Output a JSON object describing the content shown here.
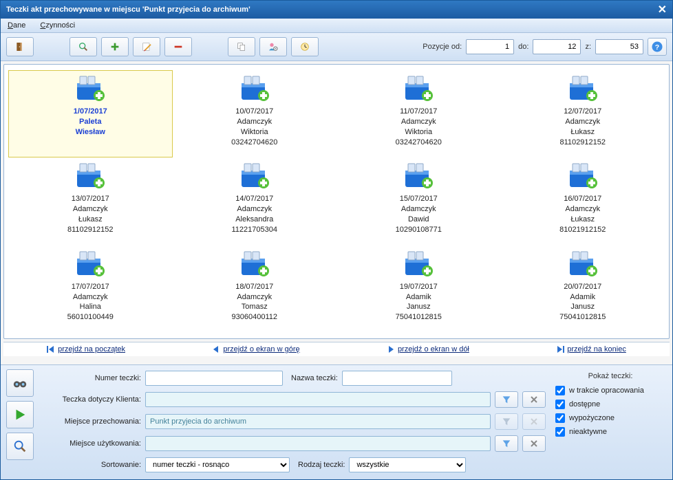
{
  "window_title": "Teczki akt przechowywane w miejscu 'Punkt przyjecia do archiwum'",
  "menu": {
    "dane": "Dane",
    "czynnosci": "Czynności"
  },
  "toolbar": {
    "pos_label_od": "Pozycje od:",
    "pos_od": "1",
    "pos_label_do": "do:",
    "pos_do": "12",
    "pos_label_z": "z:",
    "pos_z": "53"
  },
  "folders": [
    {
      "date": "1/07/2017",
      "l2": "Paleta",
      "l3": "Wiesław",
      "l4": "",
      "selected": true
    },
    {
      "date": "10/07/2017",
      "l2": "Adamczyk",
      "l3": "Wiktoria",
      "l4": "03242704620"
    },
    {
      "date": "11/07/2017",
      "l2": "Adamczyk",
      "l3": "Wiktoria",
      "l4": "03242704620"
    },
    {
      "date": "12/07/2017",
      "l2": "Adamczyk",
      "l3": "Łukasz",
      "l4": "81102912152"
    },
    {
      "date": "13/07/2017",
      "l2": "Adamczyk",
      "l3": "Łukasz",
      "l4": "81102912152"
    },
    {
      "date": "14/07/2017",
      "l2": "Adamczyk",
      "l3": "Aleksandra",
      "l4": "11221705304"
    },
    {
      "date": "15/07/2017",
      "l2": "Adamczyk",
      "l3": "Dawid",
      "l4": "10290108771"
    },
    {
      "date": "16/07/2017",
      "l2": "Adamczyk",
      "l3": "Łukasz",
      "l4": "81021912152"
    },
    {
      "date": "17/07/2017",
      "l2": "Adamczyk",
      "l3": "Halina",
      "l4": "56010100449"
    },
    {
      "date": "18/07/2017",
      "l2": "Adamczyk",
      "l3": "Tomasz",
      "l4": "93060400112"
    },
    {
      "date": "19/07/2017",
      "l2": "Adamik",
      "l3": "Janusz",
      "l4": "75041012815"
    },
    {
      "date": "20/07/2017",
      "l2": "Adamik",
      "l3": "Janusz",
      "l4": "75041012815"
    }
  ],
  "pager": {
    "first": "przejdź na początek",
    "up": "przejdź o ekran w górę",
    "down": "przejdź o ekran w dół",
    "last": "przejdź na koniec"
  },
  "form": {
    "numer_label": "Numer teczki:",
    "numer": "",
    "nazwa_label": "Nazwa teczki:",
    "nazwa": "",
    "klient_label": "Teczka dotyczy Klienta:",
    "klient": "",
    "miejsce_p_label": "Miejsce przechowania:",
    "miejsce_p": "Punkt przyjecia do archiwum",
    "miejsce_u_label": "Miejsce użytkowania:",
    "miejsce_u": "",
    "sort_label": "Sortowanie:",
    "sort_value": "numer teczki - rosnąco",
    "rodzaj_label": "Rodzaj teczki:",
    "rodzaj_value": "wszystkie"
  },
  "checks": {
    "title": "Pokaż teczki:",
    "c1": "w trakcie opracowania",
    "c2": "dostępne",
    "c3": "wypożyczone",
    "c4": "nieaktywne"
  }
}
